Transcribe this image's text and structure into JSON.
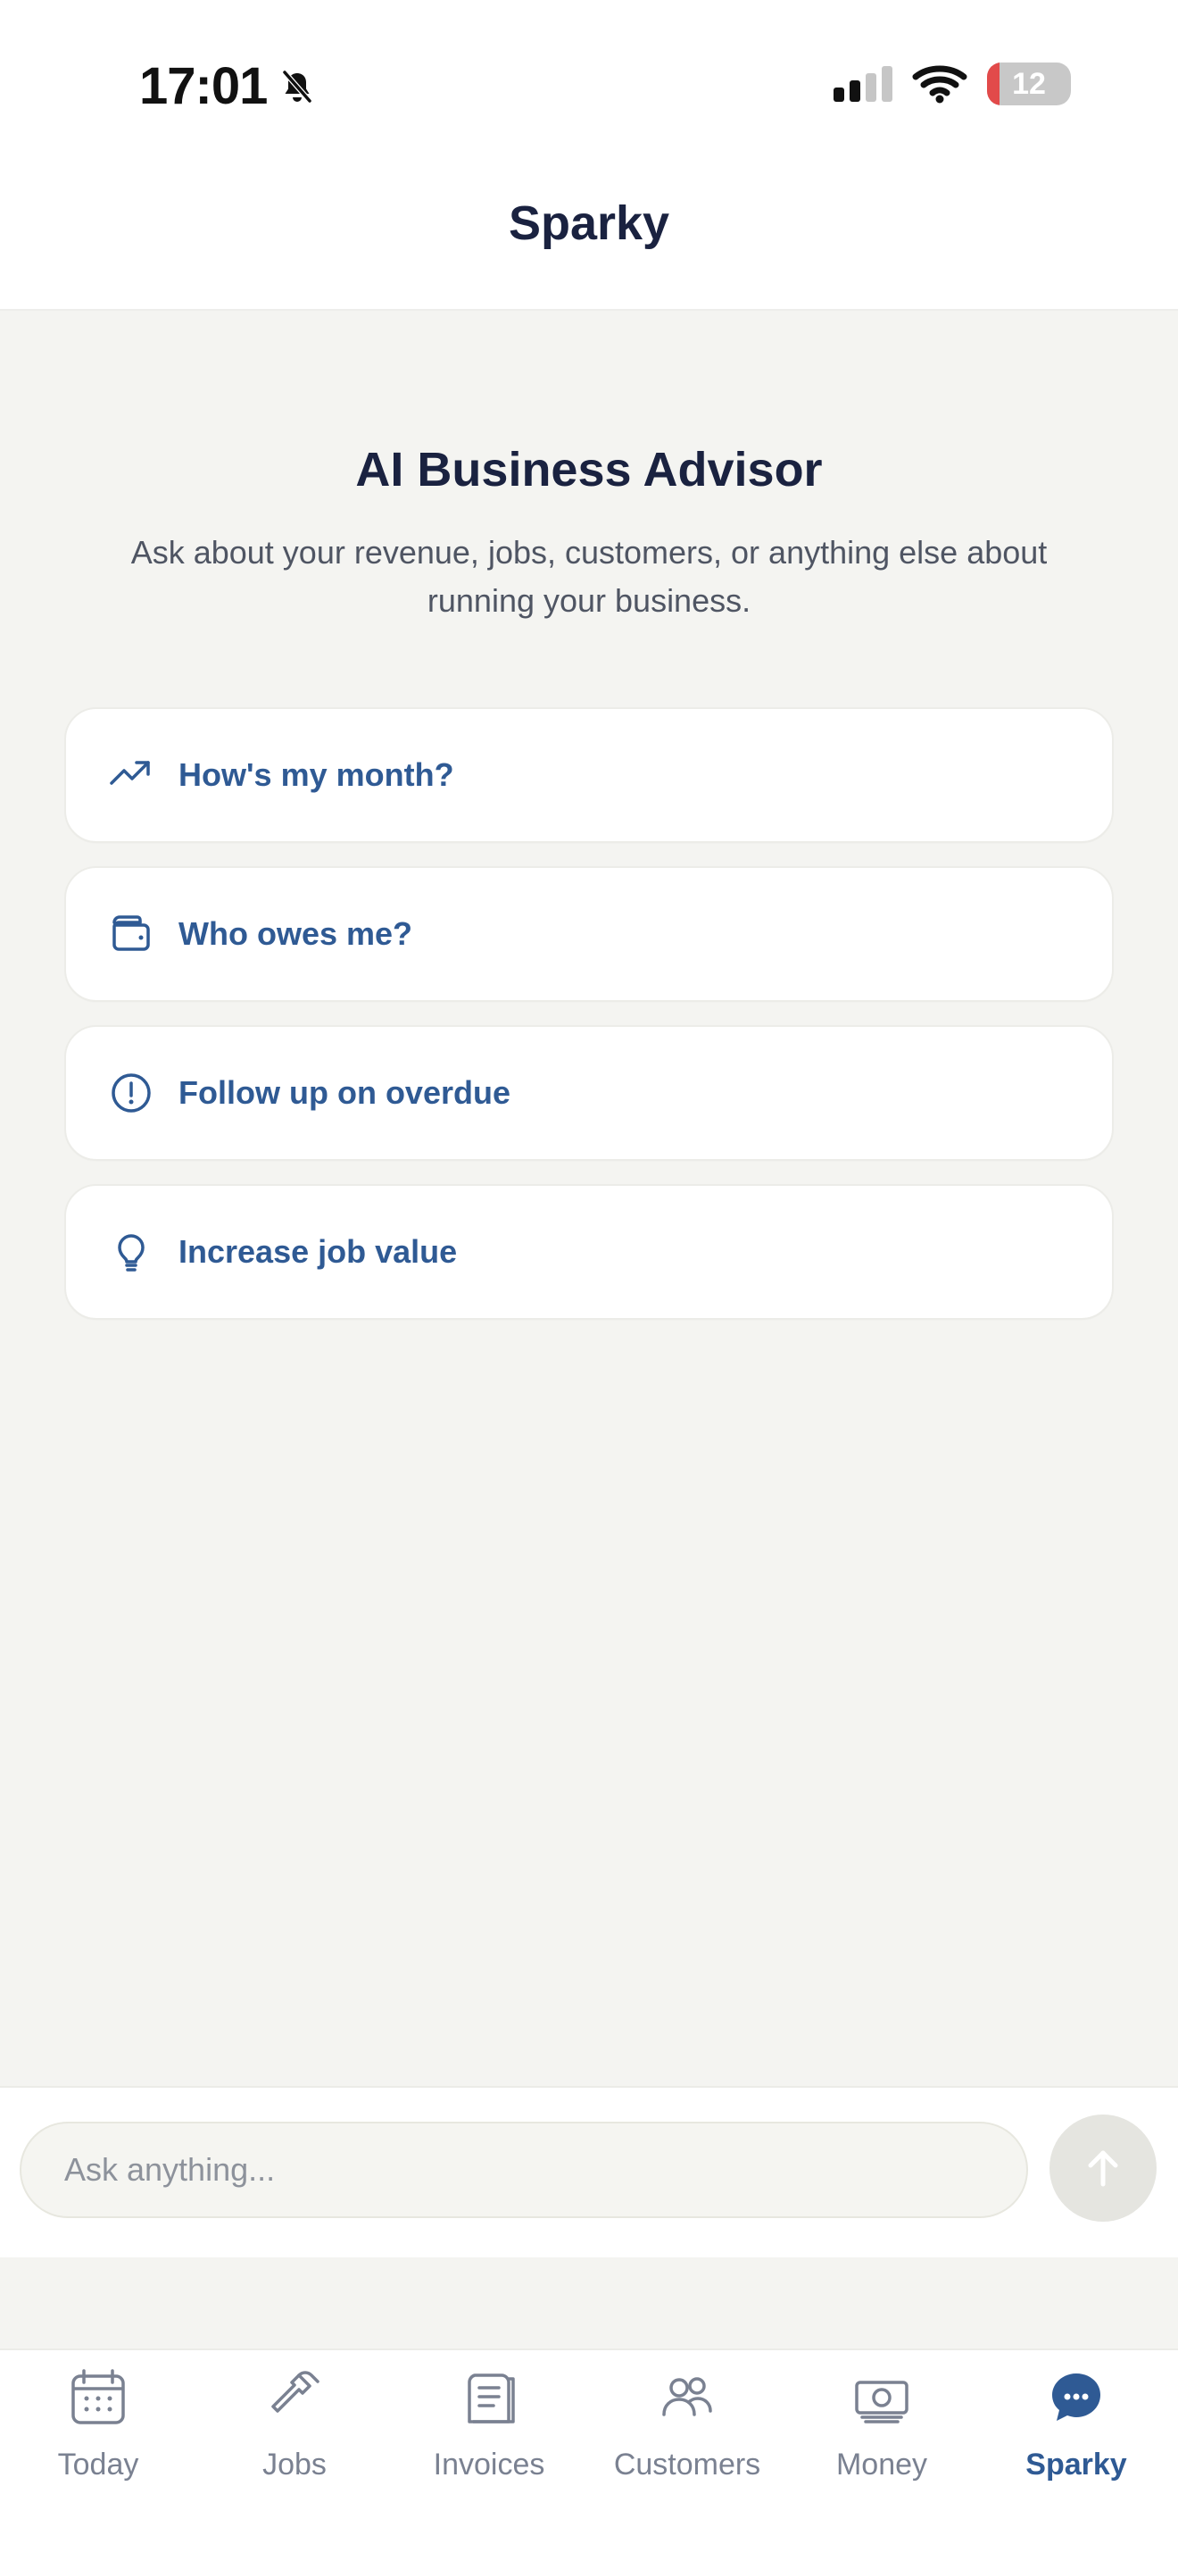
{
  "status_bar": {
    "time": "17:01",
    "battery_level": "12"
  },
  "header": {
    "title": "Sparky"
  },
  "intro": {
    "title": "AI Business Advisor",
    "subtitle": "Ask about your revenue, jobs, customers, or anything else about running your business."
  },
  "suggestions": [
    {
      "label": "How's my month?",
      "icon": "trend-up-icon"
    },
    {
      "label": "Who owes me?",
      "icon": "wallet-icon"
    },
    {
      "label": "Follow up on overdue",
      "icon": "alert-circle-icon"
    },
    {
      "label": "Increase job value",
      "icon": "lightbulb-icon"
    }
  ],
  "composer": {
    "placeholder": "Ask anything..."
  },
  "tabs": [
    {
      "label": "Today",
      "icon": "calendar-icon"
    },
    {
      "label": "Jobs",
      "icon": "hammer-icon"
    },
    {
      "label": "Invoices",
      "icon": "receipt-icon"
    },
    {
      "label": "Customers",
      "icon": "users-icon"
    },
    {
      "label": "Money",
      "icon": "cash-icon"
    },
    {
      "label": "Sparky",
      "icon": "chat-bubble-icon"
    }
  ],
  "colors": {
    "accent": "#2f5a94",
    "navy": "#1a2240",
    "background": "#f4f4f1",
    "tab_inactive": "#7a8191"
  }
}
